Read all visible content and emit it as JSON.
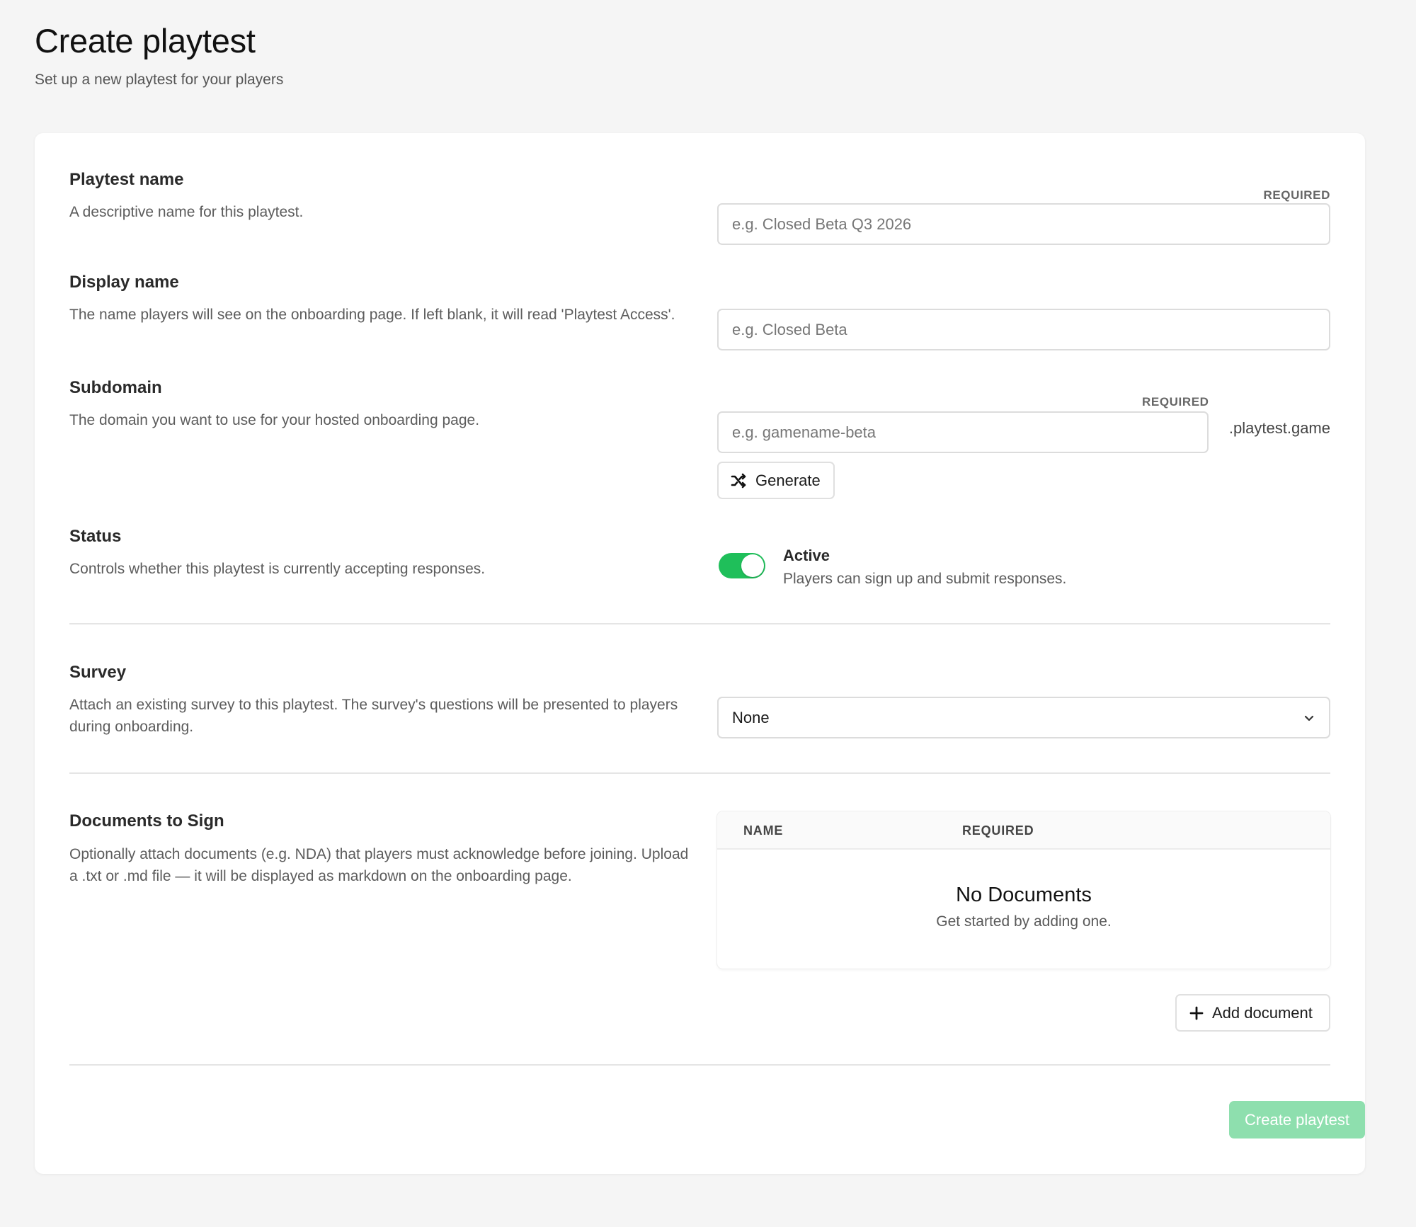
{
  "header": {
    "title": "Create playtest",
    "subtitle": "Set up a new playtest for your players"
  },
  "fields": {
    "playtest_name": {
      "label": "Playtest name",
      "description": "A descriptive name for this playtest.",
      "required_label": "REQUIRED",
      "placeholder": "e.g. Closed Beta Q3 2026",
      "value": ""
    },
    "display_name": {
      "label": "Display name",
      "description": "The name players will see on the onboarding page. If left blank, it will read 'Playtest Access'.",
      "placeholder": "e.g. Closed Beta",
      "value": ""
    },
    "subdomain": {
      "label": "Subdomain",
      "description": "The domain you want to use for your hosted onboarding page.",
      "required_label": "REQUIRED",
      "placeholder": "e.g. gamename-beta",
      "value": "",
      "suffix": ".playtest.game",
      "generate_label": "Generate",
      "generate_icon": "shuffle-icon"
    },
    "status": {
      "label": "Status",
      "description": "Controls whether this playtest is currently accepting responses.",
      "toggle_on": true,
      "state_title": "Active",
      "state_description": "Players can sign up and submit responses."
    },
    "survey": {
      "label": "Survey",
      "description": "Attach an existing survey to this playtest. The survey's questions will be presented to players during onboarding.",
      "selected": "None",
      "chevron_icon": "chevron-down-icon"
    },
    "documents": {
      "label": "Documents to Sign",
      "description": "Optionally attach documents (e.g. NDA) that players must acknowledge before joining. Upload a .txt or .md file — it will be displayed as markdown on the onboarding page.",
      "columns": [
        "NAME",
        "REQUIRED"
      ],
      "rows": [],
      "empty_title": "No Documents",
      "empty_subtitle": "Get started by adding one.",
      "add_label": "Add document",
      "add_icon": "plus-icon"
    }
  },
  "actions": {
    "submit_label": "Create playtest",
    "submit_enabled": false
  },
  "colors": {
    "background": "#f5f5f5",
    "card": "#ffffff",
    "toggle_on": "#1fbf5a",
    "primary_disabled": "#8edfae"
  }
}
